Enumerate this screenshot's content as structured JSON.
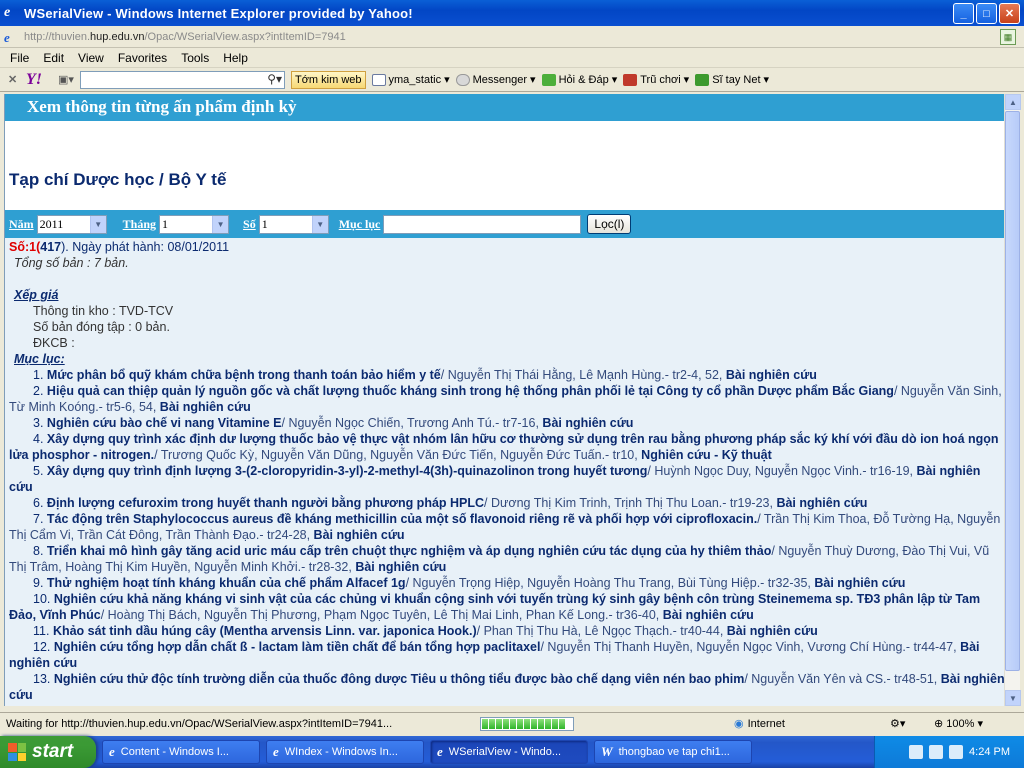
{
  "window": {
    "title": "WSerialView - Windows Internet Explorer provided by Yahoo!"
  },
  "address": {
    "prefix": "http://thuvien.",
    "host": "hup.edu.vn",
    "path": "/Opac/WSerialView.aspx?intItemID=7941"
  },
  "menu": [
    "File",
    "Edit",
    "View",
    "Favorites",
    "Tools",
    "Help"
  ],
  "toolbar": {
    "search_button": "Tớm kim web",
    "items": [
      "yma_static",
      "Messenger",
      "Hỏi & Đáp",
      "Trũ chơi",
      "Sĩ tay Net"
    ]
  },
  "page": {
    "header": "Xem thông tin từng ấn phẩm định kỳ",
    "pub_title": "Tạp chí Dược học / Bộ Y tế",
    "filters": {
      "year_label": "Năm",
      "year_value": "2011",
      "month_label": "Tháng",
      "month_value": "1",
      "issue_label": "Số",
      "issue_value": "1",
      "toc_label": "Mục lục",
      "toc_value": "",
      "search_button": "Lọc(l)"
    },
    "issue": {
      "so_label": "Số:1",
      "num": "417",
      "release": "). Ngày phát hành: 08/01/2011"
    },
    "copies": "Tổng số bản : 7 bản.",
    "xep_gia": "Xếp giá",
    "info": [
      "Thông tin kho : TVD-TCV",
      "Số bản đóng tập : 0 bản.",
      "ĐKCB :"
    ],
    "muc_luc": "Mục lục:",
    "articles": [
      {
        "n": "1.",
        "title": "Mức phân bổ quỹ khám chữa bệnh trong thanh toán bảo hiểm y tế",
        "authors": "/ Nguyễn Thị Thái Hằng, Lê Mạnh Hùng.- tr2-4, 52, ",
        "type": "Bài nghiên cứu"
      },
      {
        "n": "2.",
        "title": "Hiệu quả can thiệp quản lý nguồn gốc và chất lượng thuốc kháng sinh trong hệ thống phân phối lẻ tại Công ty cổ phần Dược phẩm Bắc Giang",
        "authors": "/ Nguyễn Văn Sinh, Từ Minh Koóng.- tr5-6, 54, ",
        "type": "Bài nghiên cứu"
      },
      {
        "n": "3.",
        "title": "Nghiên cứu bào chế vi nang Vitamine E",
        "authors": "/ Nguyễn Ngọc Chiến, Trương Anh Tú.- tr7-16, ",
        "type": "Bài nghiên cứu"
      },
      {
        "n": "4.",
        "title": "Xây dựng quy trình xác định dư lượng thuốc bảo vệ thực vật nhóm lân hữu cơ thường sử dụng trên rau bằng phương pháp sắc ký khí với đầu dò ion hoá ngọn lửa phosphor - nitrogen.",
        "authors": "/ Trương Quốc Kỳ, Nguyễn Văn Dũng, Nguyễn Văn Đức Tiến, Nguyễn Đức Tuấn.- tr10, ",
        "type": "Nghiên cứu - Kỹ thuật"
      },
      {
        "n": "5.",
        "title": "Xây dựng quy trình định lượng 3-(2-cloropyridin-3-yl)-2-methyl-4(3h)-quinazolinon trong huyết tương",
        "authors": "/ Huỳnh Ngọc Duy, Nguyễn Ngọc Vinh.- tr16-19, ",
        "type": "Bài nghiên cứu"
      },
      {
        "n": "6.",
        "title": "Định lượng cefuroxim trong huyết thanh người bằng phương pháp HPLC",
        "authors": "/ Dương Thị Kim Trinh, Trịnh Thị Thu Loan.- tr19-23, ",
        "type": "Bài nghiên cứu"
      },
      {
        "n": "7.",
        "title": "Tác động trên Staphylococcus aureus đề kháng methicillin của một số flavonoid riêng rẽ và phối hợp với ciprofloxacin.",
        "authors": "/ Trần Thị Kim Thoa, Đỗ Tường Hạ, Nguyễn Thị Cẩm Vi, Trần Cát Đông, Trần Thành Đạo.- tr24-28, ",
        "type": "Bài nghiên cứu"
      },
      {
        "n": "8.",
        "title": "Triển khai mô hình gây tăng acid uric máu cấp trên chuột thực nghiệm và áp dụng nghiên cứu tác dụng của hy thiêm thảo",
        "authors": "/ Nguyễn Thuỳ Dương, Đào Thị Vui, Vũ Thị Trâm, Hoàng Thị Kim Huyền, Nguyễn Minh Khởi.- tr28-32, ",
        "type": "Bài nghiên cứu"
      },
      {
        "n": "9.",
        "title": "Thử nghiệm hoạt tính kháng khuẩn của chế phẩm Alfacef 1g",
        "authors": "/ Nguyễn Trọng Hiệp, Nguyễn Hoàng Thu Trang, Bùi Tùng Hiệp.- tr32-35, ",
        "type": "Bài nghiên cứu"
      },
      {
        "n": "10.",
        "title": "Nghiên cứu khả năng kháng vi sinh vật của các chủng vi khuẩn cộng sinh với tuyến trùng ký sinh gây bệnh côn trùng Steinemema sp. TĐ3 phân lập từ Tam Đảo, Vĩnh Phúc",
        "authors": "/ Hoàng Thị Bách, Nguyễn Thị Phương, Phạm Ngọc Tuyên, Lê Thị Mai Linh, Phan Kế Long.- tr36-40, ",
        "type": "Bài nghiên cứu"
      },
      {
        "n": "11.",
        "title": "Khảo sát tinh dầu húng cây (Mentha arvensis Linn. var. japonica Hook.)",
        "authors": "/ Phan Thị Thu Hà, Lê Ngọc Thạch.- tr40-44, ",
        "type": "Bài nghiên cứu"
      },
      {
        "n": "12.",
        "title": "Nghiên cứu tổng hợp dẫn chất ß - lactam làm tiền chất để bán tổng hợp paclitaxel",
        "authors": "/ Nguyễn Thị Thanh Huyền, Nguyễn Ngọc Vinh, Vương Chí Hùng.- tr44-47, ",
        "type": "Bài nghiên cứu"
      },
      {
        "n": "13.",
        "title": "Nghiên cứu thử độc tính trường diễn của thuốc đông dược Tiêu u thông tiểu được bào chế dạng viên nén bao phim",
        "authors": "/ Nguyễn Văn Yên và CS.- tr48-51, ",
        "type": "Bài nghiên cứu"
      }
    ]
  },
  "status": {
    "message": "Waiting for http://thuvien.hup.edu.vn/Opac/WSerialView.aspx?intItemID=7941...",
    "zone": "Internet",
    "zoom": "100%"
  },
  "taskbar": {
    "start": "start",
    "tasks": [
      "Content - Windows I...",
      "WIndex - Windows In...",
      "WSerialView - Windo...",
      "thongbao ve tap chi1..."
    ],
    "time": "4:24 PM"
  }
}
